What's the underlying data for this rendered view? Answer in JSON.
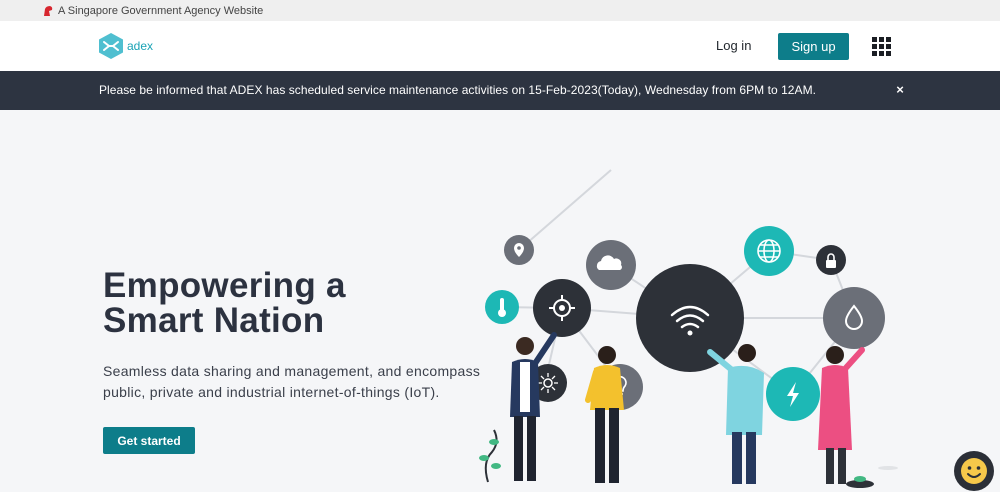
{
  "gov_bar": {
    "text": "A Singapore Government Agency Website"
  },
  "header": {
    "logo_text": "adex",
    "login_label": "Log in",
    "signup_label": "Sign up"
  },
  "notice": {
    "text": "Please be informed that ADEX has scheduled service maintenance activities on 15-Feb-2023(Today), Wednesday from 6PM to 12AM.",
    "close_glyph": "×"
  },
  "hero": {
    "title_line1": "Empowering a",
    "title_line2": "Smart Nation",
    "subtitle": "Seamless data sharing and management, and encompass public, private and industrial internet-of-things (IoT).",
    "cta_label": "Get started"
  },
  "colors": {
    "brand": "#0d7d8a",
    "teal": "#1db8b5",
    "dark_circle": "#2d3138",
    "gray_circle": "#6b6f78",
    "notice_bg": "#2d3441"
  }
}
